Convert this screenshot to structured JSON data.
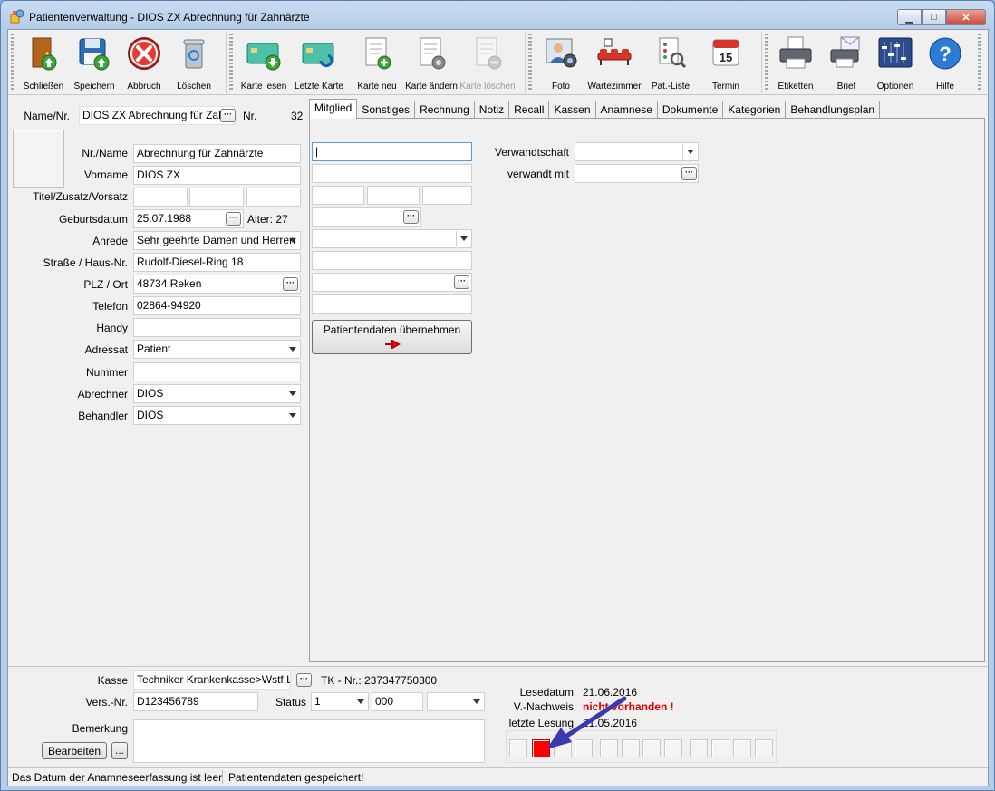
{
  "window": {
    "title": "Patientenverwaltung - DIOS ZX Abrechnung für Zahnärzte",
    "controls": {
      "minimize": "▁",
      "maximize": "□",
      "close": "✕"
    }
  },
  "toolbar": {
    "buttons": [
      {
        "label": "Schließen",
        "icon": "door-exit-icon"
      },
      {
        "label": "Speichern",
        "icon": "floppy-save-icon"
      },
      {
        "label": "Abbruch",
        "icon": "cancel-x-icon"
      },
      {
        "label": "Löschen",
        "icon": "trash-bin-icon"
      },
      {
        "label": "Karte lesen",
        "icon": "card-read-icon"
      },
      {
        "label": "Letzte Karte",
        "icon": "card-last-icon"
      },
      {
        "label": "Karte neu",
        "icon": "card-new-icon"
      },
      {
        "label": "Karte ändern",
        "icon": "card-edit-icon"
      },
      {
        "label": "Karte löschen",
        "icon": "card-delete-icon",
        "disabled": true
      },
      {
        "label": "Foto",
        "icon": "photo-camera-icon"
      },
      {
        "label": "Wartezimmer",
        "icon": "waiting-room-icon"
      },
      {
        "label": "Pat.-Liste",
        "icon": "patient-list-icon"
      },
      {
        "label": "Termin",
        "icon": "calendar-icon",
        "calendar_day": "15"
      },
      {
        "label": "Etiketten",
        "icon": "label-printer-icon"
      },
      {
        "label": "Brief",
        "icon": "letter-printer-icon"
      },
      {
        "label": "Optionen",
        "icon": "options-sliders-icon"
      },
      {
        "label": "Hilfe",
        "icon": "help-icon",
        "glyph": "?"
      }
    ]
  },
  "patient": {
    "name_nr_label": "Name/Nr.",
    "name_nr_value": "DIOS ZX Abrechnung für Zahnärzte",
    "nr_label": "Nr.",
    "nr_value": "32",
    "fields": {
      "nr_name": {
        "label": "Nr./Name",
        "value": "Abrechnung für Zahnärzte"
      },
      "vorname": {
        "label": "Vorname",
        "value": "DIOS ZX"
      },
      "titel": {
        "label": "Titel/Zusatz/Vorsatz",
        "value": ""
      },
      "geburtsdatum": {
        "label": "Geburtsdatum",
        "value": "25.07.1988",
        "alter": "Alter: 27"
      },
      "anrede": {
        "label": "Anrede",
        "value": "Sehr geehrte Damen und Herren"
      },
      "strasse": {
        "label": "Straße / Haus-Nr.",
        "value": "Rudolf-Diesel-Ring 18"
      },
      "plz_ort": {
        "label": "PLZ / Ort",
        "value": "48734 Reken"
      },
      "telefon": {
        "label": "Telefon",
        "value": "02864-94920"
      },
      "handy": {
        "label": "Handy",
        "value": ""
      },
      "adressat": {
        "label": "Adressat",
        "value": "Patient"
      },
      "nummer": {
        "label": "Nummer",
        "value": ""
      },
      "abrechner": {
        "label": "Abrechner",
        "value": "DIOS"
      },
      "behandler": {
        "label": "Behandler",
        "value": "DIOS"
      }
    }
  },
  "tabs": [
    "Mitglied",
    "Sonstiges",
    "Rechnung",
    "Notiz",
    "Recall",
    "Kassen",
    "Anamnese",
    "Dokumente",
    "Kategorien",
    "Behandlungsplan"
  ],
  "mitglied": {
    "verwandtschaft_label": "Verwandtschaft",
    "verwandt_mit_label": "verwandt mit",
    "uebernehmen_button": "Patientendaten übernehmen"
  },
  "insurance": {
    "kasse_label": "Kasse",
    "kasse_value": "Techniker Krankenkasse>Wstf.L.",
    "tk_nr": "TK - Nr.: 237347750300",
    "vers_nr_label": "Vers.-Nr.",
    "vers_nr_value": "D123456789",
    "status_label": "Status",
    "status_value": "1",
    "status_code": "000",
    "status_extra": "",
    "bemerkung_label": "Bemerkung",
    "bearbeiten_button": "Bearbeiten",
    "more_button": "...",
    "lesedatum_label": "Lesedatum",
    "lesedatum_value": "21.06.2016",
    "vnachweis_label": "V.-Nachweis",
    "vnachweis_value": "nicht vorhanden !",
    "letzte_lesung_label": "letzte Lesung",
    "letzte_lesung_value": "21.05.2016"
  },
  "indicators": {
    "active_index": 1,
    "count": 12
  },
  "statusbar": {
    "left": "Das Datum der Anamneseerfassung ist leer",
    "right": "Patientendaten gespeichert!"
  },
  "colors": {
    "accent_red": "#e00000",
    "arrow_blue": "#3a3ab0",
    "indicator_red": "#ff0000"
  }
}
